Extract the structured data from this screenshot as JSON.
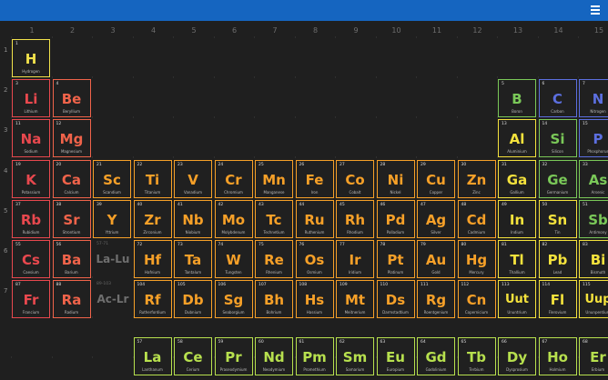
{
  "header": {
    "menu_icon": "hamburger-menu-icon"
  },
  "colors": {
    "header": "#1565c0",
    "hydrogen": "#f2e24b",
    "alkali": "#e8484e",
    "alkaline": "#f0634a",
    "transition": "#f6a028",
    "post_transition": "#f4e23c",
    "metalloid": "#7ac858",
    "nonmetal": "#5c6fe0",
    "lanthanide": "#b7e04e"
  },
  "column_labels": [
    "1",
    "2",
    "3",
    "4",
    "5",
    "6",
    "7",
    "8",
    "9",
    "10",
    "11",
    "12",
    "13",
    "14",
    "15"
  ],
  "row_labels": [
    "1",
    "2",
    "3",
    "4",
    "5",
    "6",
    "7"
  ],
  "placeholders": [
    {
      "num": "57-71",
      "symbol": "La-Lu",
      "col": 3,
      "row": 6
    },
    {
      "num": "89-103",
      "symbol": "Ac-Lr",
      "col": 3,
      "row": 7
    }
  ],
  "elements": [
    {
      "num": "1",
      "symbol": "H",
      "name": "Hydrogen",
      "col": 1,
      "row": 1,
      "cat": "hydrogen"
    },
    {
      "num": "3",
      "symbol": "Li",
      "name": "Lithium",
      "col": 1,
      "row": 2,
      "cat": "alkali"
    },
    {
      "num": "4",
      "symbol": "Be",
      "name": "Beryllium",
      "col": 2,
      "row": 2,
      "cat": "alkaline"
    },
    {
      "num": "5",
      "symbol": "B",
      "name": "Boron",
      "col": 13,
      "row": 2,
      "cat": "metalloid"
    },
    {
      "num": "6",
      "symbol": "C",
      "name": "Carbon",
      "col": 14,
      "row": 2,
      "cat": "nonmetal"
    },
    {
      "num": "7",
      "symbol": "N",
      "name": "Nitrogen",
      "col": 15,
      "row": 2,
      "cat": "nonmetal"
    },
    {
      "num": "11",
      "symbol": "Na",
      "name": "Sodium",
      "col": 1,
      "row": 3,
      "cat": "alkali"
    },
    {
      "num": "12",
      "symbol": "Mg",
      "name": "Magnesium",
      "col": 2,
      "row": 3,
      "cat": "alkaline"
    },
    {
      "num": "13",
      "symbol": "Al",
      "name": "Aluminium",
      "col": 13,
      "row": 3,
      "cat": "post_transition"
    },
    {
      "num": "14",
      "symbol": "Si",
      "name": "Silicon",
      "col": 14,
      "row": 3,
      "cat": "metalloid"
    },
    {
      "num": "15",
      "symbol": "P",
      "name": "Phosphorus",
      "col": 15,
      "row": 3,
      "cat": "nonmetal"
    },
    {
      "num": "19",
      "symbol": "K",
      "name": "Potassium",
      "col": 1,
      "row": 4,
      "cat": "alkali"
    },
    {
      "num": "20",
      "symbol": "Ca",
      "name": "Calcium",
      "col": 2,
      "row": 4,
      "cat": "alkaline"
    },
    {
      "num": "21",
      "symbol": "Sc",
      "name": "Scandium",
      "col": 3,
      "row": 4,
      "cat": "transition"
    },
    {
      "num": "22",
      "symbol": "Ti",
      "name": "Titanium",
      "col": 4,
      "row": 4,
      "cat": "transition"
    },
    {
      "num": "23",
      "symbol": "V",
      "name": "Vanadium",
      "col": 5,
      "row": 4,
      "cat": "transition"
    },
    {
      "num": "24",
      "symbol": "Cr",
      "name": "Chromium",
      "col": 6,
      "row": 4,
      "cat": "transition"
    },
    {
      "num": "25",
      "symbol": "Mn",
      "name": "Manganese",
      "col": 7,
      "row": 4,
      "cat": "transition"
    },
    {
      "num": "26",
      "symbol": "Fe",
      "name": "Iron",
      "col": 8,
      "row": 4,
      "cat": "transition"
    },
    {
      "num": "27",
      "symbol": "Co",
      "name": "Cobalt",
      "col": 9,
      "row": 4,
      "cat": "transition"
    },
    {
      "num": "28",
      "symbol": "Ni",
      "name": "Nickel",
      "col": 10,
      "row": 4,
      "cat": "transition"
    },
    {
      "num": "29",
      "symbol": "Cu",
      "name": "Copper",
      "col": 11,
      "row": 4,
      "cat": "transition"
    },
    {
      "num": "30",
      "symbol": "Zn",
      "name": "Zinc",
      "col": 12,
      "row": 4,
      "cat": "transition"
    },
    {
      "num": "31",
      "symbol": "Ga",
      "name": "Gallium",
      "col": 13,
      "row": 4,
      "cat": "post_transition"
    },
    {
      "num": "32",
      "symbol": "Ge",
      "name": "Germanium",
      "col": 14,
      "row": 4,
      "cat": "metalloid"
    },
    {
      "num": "33",
      "symbol": "As",
      "name": "Arsenic",
      "col": 15,
      "row": 4,
      "cat": "metalloid"
    },
    {
      "num": "37",
      "symbol": "Rb",
      "name": "Rubidium",
      "col": 1,
      "row": 5,
      "cat": "alkali"
    },
    {
      "num": "38",
      "symbol": "Sr",
      "name": "Strontium",
      "col": 2,
      "row": 5,
      "cat": "alkaline"
    },
    {
      "num": "39",
      "symbol": "Y",
      "name": "Yttrium",
      "col": 3,
      "row": 5,
      "cat": "transition"
    },
    {
      "num": "40",
      "symbol": "Zr",
      "name": "Zirconium",
      "col": 4,
      "row": 5,
      "cat": "transition"
    },
    {
      "num": "41",
      "symbol": "Nb",
      "name": "Niobium",
      "col": 5,
      "row": 5,
      "cat": "transition"
    },
    {
      "num": "42",
      "symbol": "Mo",
      "name": "Molybdenum",
      "col": 6,
      "row": 5,
      "cat": "transition"
    },
    {
      "num": "43",
      "symbol": "Tc",
      "name": "Technetium",
      "col": 7,
      "row": 5,
      "cat": "transition"
    },
    {
      "num": "44",
      "symbol": "Ru",
      "name": "Ruthenium",
      "col": 8,
      "row": 5,
      "cat": "transition"
    },
    {
      "num": "45",
      "symbol": "Rh",
      "name": "Rhodium",
      "col": 9,
      "row": 5,
      "cat": "transition"
    },
    {
      "num": "46",
      "symbol": "Pd",
      "name": "Palladium",
      "col": 10,
      "row": 5,
      "cat": "transition"
    },
    {
      "num": "47",
      "symbol": "Ag",
      "name": "Silver",
      "col": 11,
      "row": 5,
      "cat": "transition"
    },
    {
      "num": "48",
      "symbol": "Cd",
      "name": "Cadmium",
      "col": 12,
      "row": 5,
      "cat": "transition"
    },
    {
      "num": "49",
      "symbol": "In",
      "name": "Indium",
      "col": 13,
      "row": 5,
      "cat": "post_transition"
    },
    {
      "num": "50",
      "symbol": "Sn",
      "name": "Tin",
      "col": 14,
      "row": 5,
      "cat": "post_transition"
    },
    {
      "num": "51",
      "symbol": "Sb",
      "name": "Antimony",
      "col": 15,
      "row": 5,
      "cat": "metalloid"
    },
    {
      "num": "55",
      "symbol": "Cs",
      "name": "Caesium",
      "col": 1,
      "row": 6,
      "cat": "alkali"
    },
    {
      "num": "56",
      "symbol": "Ba",
      "name": "Barium",
      "col": 2,
      "row": 6,
      "cat": "alkaline"
    },
    {
      "num": "72",
      "symbol": "Hf",
      "name": "Hafnium",
      "col": 4,
      "row": 6,
      "cat": "transition"
    },
    {
      "num": "73",
      "symbol": "Ta",
      "name": "Tantalum",
      "col": 5,
      "row": 6,
      "cat": "transition"
    },
    {
      "num": "74",
      "symbol": "W",
      "name": "Tungsten",
      "col": 6,
      "row": 6,
      "cat": "transition"
    },
    {
      "num": "75",
      "symbol": "Re",
      "name": "Rhenium",
      "col": 7,
      "row": 6,
      "cat": "transition"
    },
    {
      "num": "76",
      "symbol": "Os",
      "name": "Osmium",
      "col": 8,
      "row": 6,
      "cat": "transition"
    },
    {
      "num": "77",
      "symbol": "Ir",
      "name": "Iridium",
      "col": 9,
      "row": 6,
      "cat": "transition"
    },
    {
      "num": "78",
      "symbol": "Pt",
      "name": "Platinum",
      "col": 10,
      "row": 6,
      "cat": "transition"
    },
    {
      "num": "79",
      "symbol": "Au",
      "name": "Gold",
      "col": 11,
      "row": 6,
      "cat": "transition"
    },
    {
      "num": "80",
      "symbol": "Hg",
      "name": "Mercury",
      "col": 12,
      "row": 6,
      "cat": "transition"
    },
    {
      "num": "81",
      "symbol": "Tl",
      "name": "Thallium",
      "col": 13,
      "row": 6,
      "cat": "post_transition"
    },
    {
      "num": "82",
      "symbol": "Pb",
      "name": "Lead",
      "col": 14,
      "row": 6,
      "cat": "post_transition"
    },
    {
      "num": "83",
      "symbol": "Bi",
      "name": "Bismuth",
      "col": 15,
      "row": 6,
      "cat": "post_transition"
    },
    {
      "num": "87",
      "symbol": "Fr",
      "name": "Francium",
      "col": 1,
      "row": 7,
      "cat": "alkali"
    },
    {
      "num": "88",
      "symbol": "Ra",
      "name": "Radium",
      "col": 2,
      "row": 7,
      "cat": "alkaline"
    },
    {
      "num": "104",
      "symbol": "Rf",
      "name": "Rutherfordium",
      "col": 4,
      "row": 7,
      "cat": "transition"
    },
    {
      "num": "105",
      "symbol": "Db",
      "name": "Dubnium",
      "col": 5,
      "row": 7,
      "cat": "transition"
    },
    {
      "num": "106",
      "symbol": "Sg",
      "name": "Seaborgium",
      "col": 6,
      "row": 7,
      "cat": "transition"
    },
    {
      "num": "107",
      "symbol": "Bh",
      "name": "Bohrium",
      "col": 7,
      "row": 7,
      "cat": "transition"
    },
    {
      "num": "108",
      "symbol": "Hs",
      "name": "Hassium",
      "col": 8,
      "row": 7,
      "cat": "transition"
    },
    {
      "num": "109",
      "symbol": "Mt",
      "name": "Meitnerium",
      "col": 9,
      "row": 7,
      "cat": "transition"
    },
    {
      "num": "110",
      "symbol": "Ds",
      "name": "Darmstadtium",
      "col": 10,
      "row": 7,
      "cat": "transition"
    },
    {
      "num": "111",
      "symbol": "Rg",
      "name": "Roentgenium",
      "col": 11,
      "row": 7,
      "cat": "transition"
    },
    {
      "num": "112",
      "symbol": "Cn",
      "name": "Copernicium",
      "col": 12,
      "row": 7,
      "cat": "transition"
    },
    {
      "num": "113",
      "symbol": "Uut",
      "name": "Ununtrium",
      "col": 13,
      "row": 7,
      "cat": "post_transition"
    },
    {
      "num": "114",
      "symbol": "Fl",
      "name": "Flerovium",
      "col": 14,
      "row": 7,
      "cat": "post_transition"
    },
    {
      "num": "115",
      "symbol": "Uup",
      "name": "Ununpentium",
      "col": 15,
      "row": 7,
      "cat": "post_transition"
    },
    {
      "num": "57",
      "symbol": "La",
      "name": "Lanthanum",
      "col": 4,
      "row": 9,
      "cat": "lanthanide"
    },
    {
      "num": "58",
      "symbol": "Ce",
      "name": "Cerium",
      "col": 5,
      "row": 9,
      "cat": "lanthanide"
    },
    {
      "num": "59",
      "symbol": "Pr",
      "name": "Praseodymium",
      "col": 6,
      "row": 9,
      "cat": "lanthanide"
    },
    {
      "num": "60",
      "symbol": "Nd",
      "name": "Neodymium",
      "col": 7,
      "row": 9,
      "cat": "lanthanide"
    },
    {
      "num": "61",
      "symbol": "Pm",
      "name": "Promethium",
      "col": 8,
      "row": 9,
      "cat": "lanthanide"
    },
    {
      "num": "62",
      "symbol": "Sm",
      "name": "Samarium",
      "col": 9,
      "row": 9,
      "cat": "lanthanide"
    },
    {
      "num": "63",
      "symbol": "Eu",
      "name": "Europium",
      "col": 10,
      "row": 9,
      "cat": "lanthanide"
    },
    {
      "num": "64",
      "symbol": "Gd",
      "name": "Gadolinium",
      "col": 11,
      "row": 9,
      "cat": "lanthanide"
    },
    {
      "num": "65",
      "symbol": "Tb",
      "name": "Terbium",
      "col": 12,
      "row": 9,
      "cat": "lanthanide"
    },
    {
      "num": "66",
      "symbol": "Dy",
      "name": "Dysprosium",
      "col": 13,
      "row": 9,
      "cat": "lanthanide"
    },
    {
      "num": "67",
      "symbol": "Ho",
      "name": "Holmium",
      "col": 14,
      "row": 9,
      "cat": "lanthanide"
    },
    {
      "num": "68",
      "symbol": "Er",
      "name": "Erbium",
      "col": 15,
      "row": 9,
      "cat": "lanthanide"
    }
  ]
}
